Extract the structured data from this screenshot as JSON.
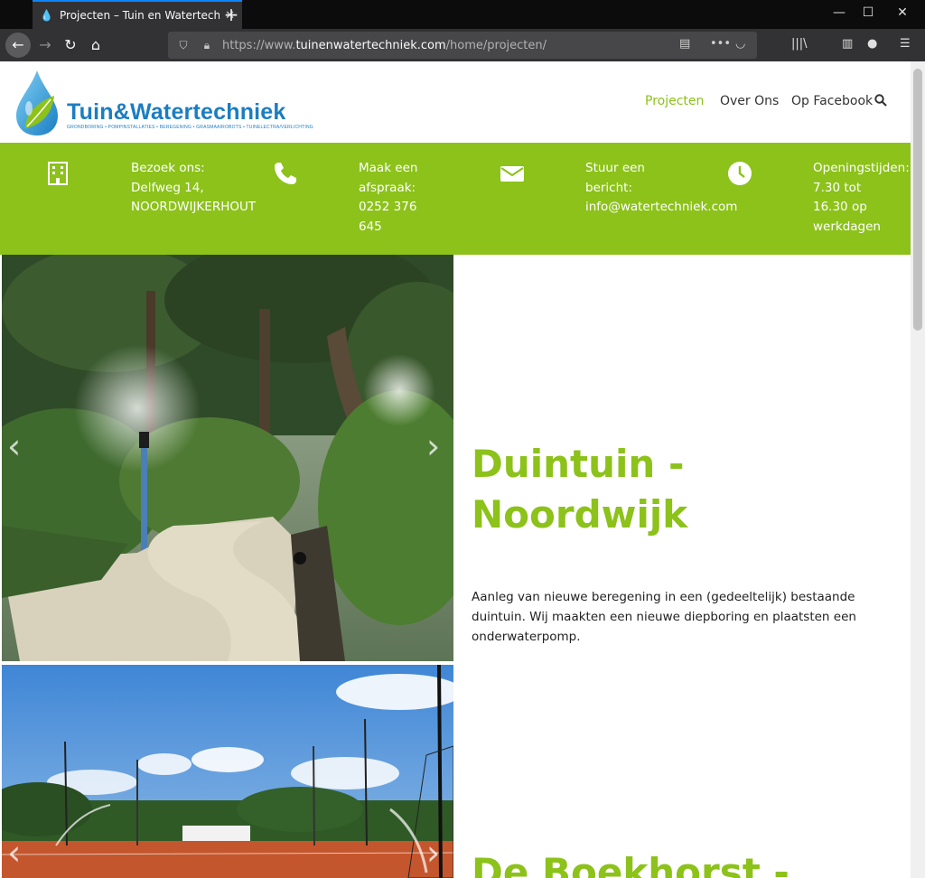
{
  "browser": {
    "tab_title": "Projecten – Tuin en Watertechniek",
    "url_prefix": "https://www.",
    "url_host": "tuinenwatertechniek.com",
    "url_path": "/home/projecten/"
  },
  "site": {
    "logo_title": "Tuin&Watertechniek",
    "logo_tagline": "GRONDBORING • POMPINSTALLATIES • BEREGENING • GRASMAAIROBOTS • TUINELECTRA/VERLICHTING",
    "menu": [
      "Projecten",
      "Over Ons",
      "Op Facebook"
    ]
  },
  "info": {
    "visit": [
      "Bezoek ons:",
      "Delfweg 14,",
      "NOORDWIJKERHOUT"
    ],
    "call": [
      "Maak een",
      "afspraak:",
      "0252 376",
      "645"
    ],
    "mail": [
      "Stuur een",
      "bericht:",
      "info@watertechniek.com"
    ],
    "hours": [
      "Openingstijden:",
      "7.30 tot",
      "16.30 op",
      "werkdagen"
    ]
  },
  "projects": [
    {
      "title_line1": "Duintuin -",
      "title_line2": "Noordwijk",
      "description": "Aanleg van nieuwe beregening in een (gedeeltelijk) bestaande duintuin. Wij maakten een nieuwe diepboring en plaatsten een onderwaterpomp."
    },
    {
      "title_line1": "De Boekhorst -"
    }
  ],
  "colors": {
    "brand_green": "#8cc21a",
    "brand_blue": "#1b7dc2"
  }
}
